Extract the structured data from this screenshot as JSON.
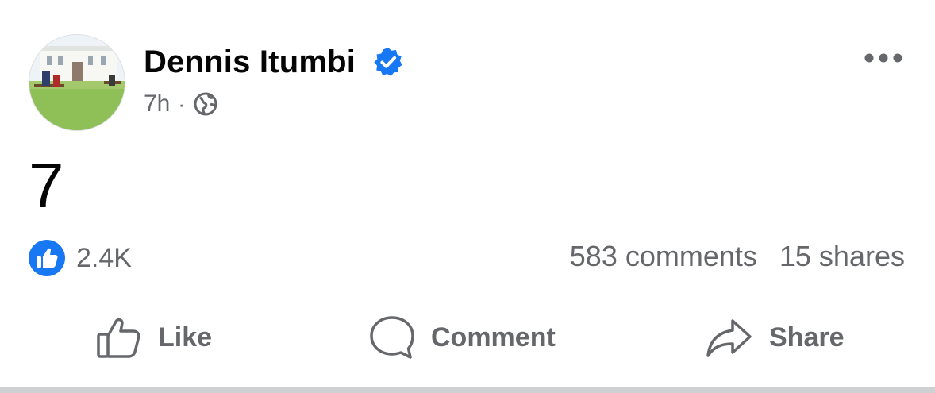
{
  "post": {
    "author": "Dennis Itumbi",
    "time": "7h",
    "separator": "·",
    "privacy_icon": "globe-icon",
    "text": "7",
    "reactions": {
      "icon": "like-reaction-icon",
      "count": "2.4K"
    },
    "comments": "583 comments",
    "shares": "15 shares",
    "actions": {
      "like": "Like",
      "comment": "Comment",
      "share": "Share"
    }
  },
  "colors": {
    "accent": "#1877f2",
    "secondary_text": "#65676b",
    "primary_text": "#050505"
  }
}
